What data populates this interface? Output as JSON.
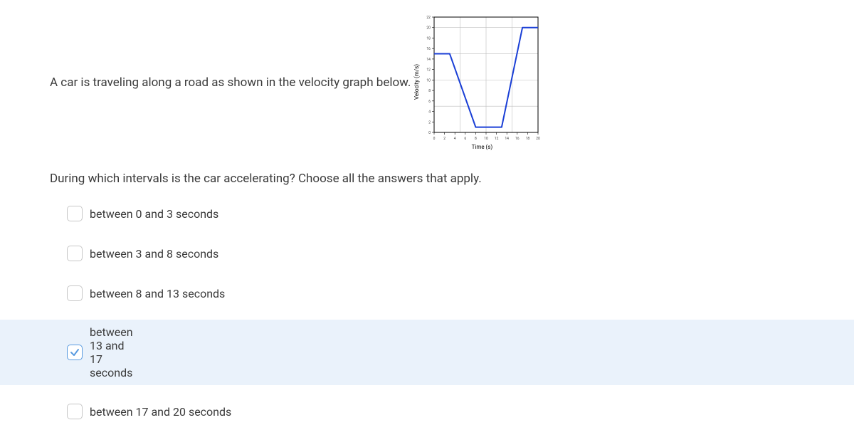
{
  "intro_text": "A car is traveling along a road as shown in the velocity graph below.",
  "question_text": "During which intervals is the car accelerating? Choose all the answers that apply.",
  "options": [
    {
      "label": "between 0 and 3 seconds",
      "checked": false
    },
    {
      "label": "between 3 and 8 seconds",
      "checked": false
    },
    {
      "label": "between 8 and 13 seconds",
      "checked": false
    },
    {
      "label": "between 13 and 17 seconds",
      "checked": true
    },
    {
      "label": "between 17 and 20 seconds",
      "checked": false
    }
  ],
  "chart_data": {
    "type": "line",
    "title": "",
    "xlabel": "Time (s)",
    "ylabel": "Velocity (m/s)",
    "xlim": [
      0,
      20
    ],
    "ylim": [
      0,
      22
    ],
    "xticks": [
      0,
      2,
      4,
      6,
      8,
      10,
      12,
      14,
      16,
      18,
      20
    ],
    "yticks": [
      0,
      2,
      4,
      6,
      8,
      10,
      12,
      14,
      16,
      18,
      20,
      22
    ],
    "xgrid_major": [
      5,
      10,
      15,
      20
    ],
    "ygrid_major": [
      5,
      10,
      15,
      20
    ],
    "series": [
      {
        "name": "velocity",
        "x": [
          0,
          3,
          8,
          10,
          13,
          17,
          20
        ],
        "y": [
          15,
          15,
          1,
          1,
          1,
          20,
          20
        ],
        "color": "#1a3fd6"
      }
    ]
  }
}
